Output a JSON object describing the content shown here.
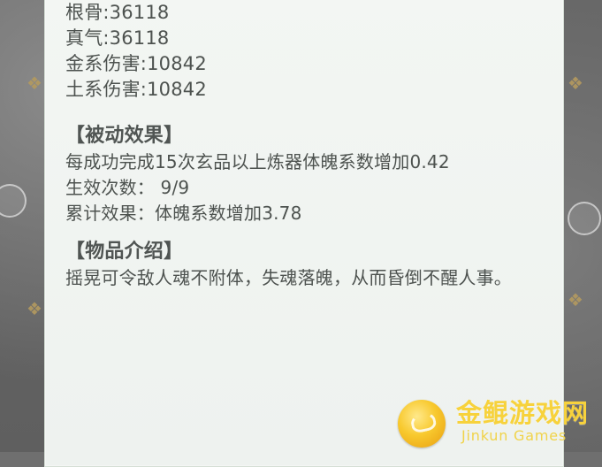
{
  "stats": [
    "根骨:36118",
    "真气:36118",
    "金系伤害:10842",
    "土系伤害:10842"
  ],
  "passive": {
    "title": "【被动效果】",
    "lines": [
      "每成功完成15次玄品以上炼器体魄系数增加0.42",
      "生效次数： 9/9",
      "累计效果：体魄系数增加3.78"
    ]
  },
  "item": {
    "title": "【物品介绍】",
    "description": "摇晃可令敌人魂不附体，失魂落魄，从而昏倒不醒人事。"
  },
  "watermark": {
    "title": "金鲲游戏网",
    "subtitle": "Jinkun Games"
  }
}
